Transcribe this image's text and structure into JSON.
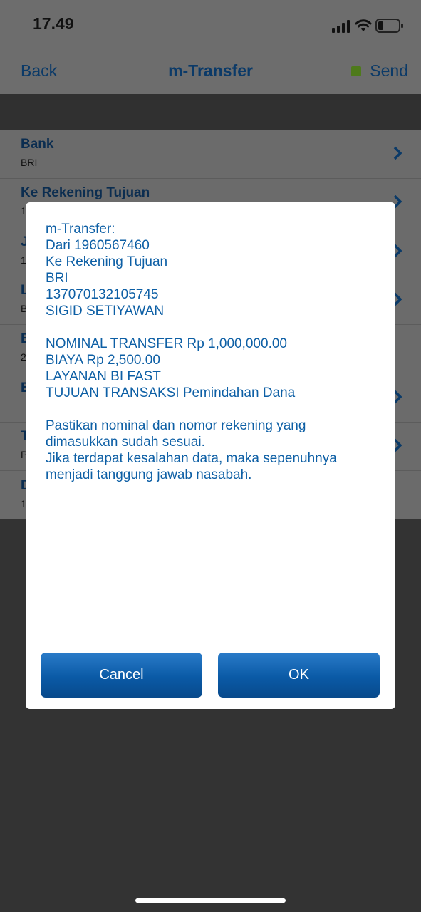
{
  "status": {
    "time": "17.49"
  },
  "nav": {
    "back": "Back",
    "title": "m-Transfer",
    "send": "Send",
    "send_dot_color": "#4e7a1b"
  },
  "list": {
    "rows": [
      {
        "title": "Bank",
        "value": "BRI"
      },
      {
        "title": "Ke Rekening Tujuan",
        "value": "1"
      },
      {
        "title": "J",
        "value": "1"
      },
      {
        "title": "L",
        "value": "B"
      },
      {
        "title": "B",
        "value": "2"
      },
      {
        "title": "B",
        "value": ""
      },
      {
        "title": "T",
        "value": "P"
      },
      {
        "title": "D",
        "value": "1"
      }
    ]
  },
  "dialog": {
    "lines": [
      "m-Transfer:",
      "Dari 1960567460",
      "Ke Rekening Tujuan",
      "BRI",
      "137070132105745",
      "SIGID SETIYAWAN",
      "",
      "NOMINAL TRANSFER Rp 1,000,000.00",
      "BIAYA Rp 2,500.00",
      "LAYANAN BI FAST",
      "TUJUAN TRANSAKSI Pemindahan Dana",
      "",
      "Pastikan nominal dan nomor rekening yang",
      "dimasukkan sudah sesuai.",
      "Jika terdapat kesalahan data, maka sepenuhnya",
      "menjadi tanggung jawab nasabah."
    ],
    "cancel_label": "Cancel",
    "ok_label": "OK"
  },
  "colors": {
    "accent": "#0d5fa5",
    "button": "#0a5aa6"
  }
}
